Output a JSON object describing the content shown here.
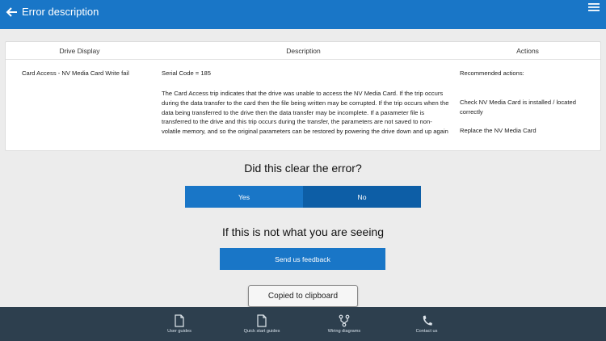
{
  "header": {
    "title": "Error description"
  },
  "table": {
    "columns": [
      "Drive Display",
      "Description",
      "Actions"
    ],
    "drive_display": "Card Access - NV Media Card Write fail",
    "serial_code": "Serial Code = 185",
    "description": "The Card Access trip indicates that the drive was unable to access the NV Media Card. If the trip occurs during the data transfer to the card then the file being written may be corrupted. If the trip occurs when the data being transferred to the drive then the data transfer may be incomplete. If a parameter file is transferred to the drive and this trip occurs during the transfer, the parameters are not saved to non-volatile memory, and so the original parameters can be restored by powering the drive down and up again",
    "actions_title": "Recommended actions:",
    "actions": [
      "Check NV Media Card is installed / located correctly",
      "Replace the NV Media Card"
    ]
  },
  "question": {
    "text": "Did this clear the error?",
    "yes_label": "Yes",
    "no_label": "No"
  },
  "feedback": {
    "text": "If this is not what you are seeing",
    "button_label": "Send us feedback"
  },
  "clipboard": {
    "label": "Copied to clipboard"
  },
  "bottom_nav": [
    {
      "label": "User guides",
      "icon": "document-icon"
    },
    {
      "label": "Quick start guides",
      "icon": "document-icon"
    },
    {
      "label": "Wiring diagrams",
      "icon": "wiring-icon"
    },
    {
      "label": "Contact us",
      "icon": "phone-icon"
    }
  ],
  "colors": {
    "primary": "#1976c7",
    "primary_dark": "#0d5ea6",
    "bottom_bar": "#2d3f4e",
    "background": "#ececec"
  }
}
